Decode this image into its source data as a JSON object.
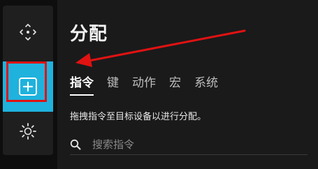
{
  "sidebar": {
    "items": [
      {
        "icon": "move-icon"
      },
      {
        "icon": "add-box-icon",
        "active": true
      },
      {
        "icon": "gear-icon"
      }
    ],
    "accent": "#1fb2dd"
  },
  "panel": {
    "title": "分配",
    "tabs": [
      {
        "label": "指令",
        "active": true
      },
      {
        "label": "键"
      },
      {
        "label": "动作"
      },
      {
        "label": "宏"
      },
      {
        "label": "系统"
      }
    ],
    "hint": "拖拽指令至目标设备以进行分配。",
    "search": {
      "placeholder": "搜索指令"
    }
  },
  "annotation": {
    "color": "#e01212"
  }
}
